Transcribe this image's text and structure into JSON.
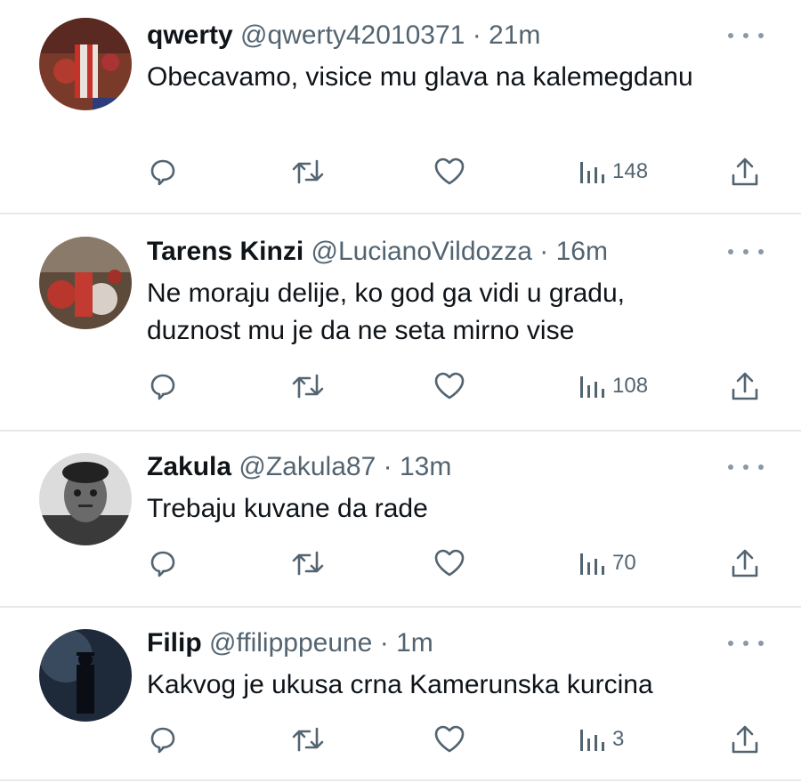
{
  "tweets": [
    {
      "name": "qwerty",
      "handle": "@qwerty42010371",
      "separator": "·",
      "time": "21m",
      "text": "Obecavamo, visice mu glava na kalemegdanu",
      "views": "148"
    },
    {
      "name": "Tarens Kinzi",
      "handle": "@LucianoVildozza",
      "separator": "·",
      "time": "16m",
      "text": "Ne moraju delije, ko god ga vidi u gradu, duznost mu je da ne seta mirno vise",
      "views": "108"
    },
    {
      "name": "Zakula",
      "handle": "@Zakula87",
      "separator": "·",
      "time": "13m",
      "text": "Trebaju kuvane da rade",
      "views": "70"
    },
    {
      "name": "Filip",
      "handle": "@ffilipppeune",
      "separator": "·",
      "time": "1m",
      "text": "Kakvog je ukusa crna Kamerunska kurcina",
      "views": "3"
    }
  ],
  "icons": {
    "reply": "reply-icon",
    "retweet": "retweet-icon",
    "like": "heart-icon",
    "views": "views-icon",
    "share": "share-icon",
    "more": "more-icon"
  },
  "colors": {
    "text": "#0f1419",
    "secondary": "#536471",
    "divider": "#e6e9ec"
  }
}
